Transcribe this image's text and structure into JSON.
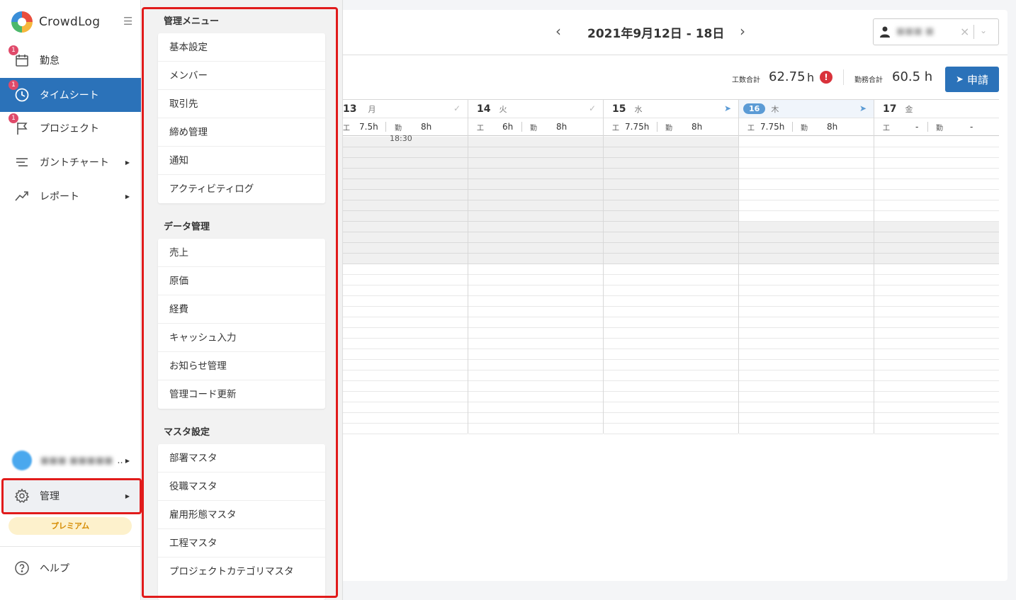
{
  "app": {
    "name": "CrowdLog"
  },
  "sidebar": {
    "items": [
      {
        "label": "勤怠",
        "badge": "1",
        "icon": "calendar-icon"
      },
      {
        "label": "タイムシート",
        "badge": "1",
        "icon": "clock-icon",
        "active": true
      },
      {
        "label": "プロジェクト",
        "badge": "1",
        "icon": "flag-icon"
      },
      {
        "label": "ガントチャート",
        "icon": "gantt-icon"
      },
      {
        "label": "レポート",
        "icon": "trend-icon"
      }
    ],
    "user_suffix": "..",
    "admin_label": "管理",
    "premium_label": "プレミアム",
    "help_label": "ヘルプ"
  },
  "admin_menu": {
    "sections": [
      {
        "title": "管理メニュー",
        "items": [
          "基本設定",
          "メンバー",
          "取引先",
          "締め管理",
          "通知",
          "アクティビティログ"
        ]
      },
      {
        "title": "データ管理",
        "items": [
          "売上",
          "原価",
          "経費",
          "キャッシュ入力",
          "お知らせ管理",
          "管理コード更新"
        ]
      },
      {
        "title": "マスタ設定",
        "items": [
          "部署マスタ",
          "役職マスタ",
          "雇用形態マスタ",
          "工程マスタ",
          "プロジェクトカテゴリマスタ"
        ]
      }
    ]
  },
  "calendar": {
    "week_title": "2021年9月12日 - 18日",
    "totals": {
      "work_label": "工数合計",
      "work_value": "62.75",
      "work_unit": "h",
      "attend_label": "勤務合計",
      "attend_value": "60.5 h"
    },
    "apply_label": "申請",
    "first_time_label": "18:30",
    "days": [
      {
        "num": "13",
        "weekday": "月",
        "status": "check",
        "work_key": "工",
        "work": "7.5h",
        "attend_key": "勤",
        "attend": "8h"
      },
      {
        "num": "14",
        "weekday": "火",
        "status": "check",
        "work_key": "工",
        "work": "6h",
        "attend_key": "勤",
        "attend": "8h"
      },
      {
        "num": "15",
        "weekday": "水",
        "status": "sent",
        "work_key": "工",
        "work": "7.75h",
        "attend_key": "勤",
        "attend": "8h"
      },
      {
        "num": "16",
        "weekday": "木",
        "status": "sent",
        "today": true,
        "work_key": "工",
        "work": "7.75h",
        "attend_key": "勤",
        "attend": "8h"
      },
      {
        "num": "17",
        "weekday": "金",
        "status": "",
        "work_key": "工",
        "work": "-",
        "attend_key": "勤",
        "attend": "-"
      }
    ]
  },
  "colors": {
    "accent": "#2b72b9",
    "highlight": "#e11b1b",
    "badge": "#e04a6a"
  }
}
